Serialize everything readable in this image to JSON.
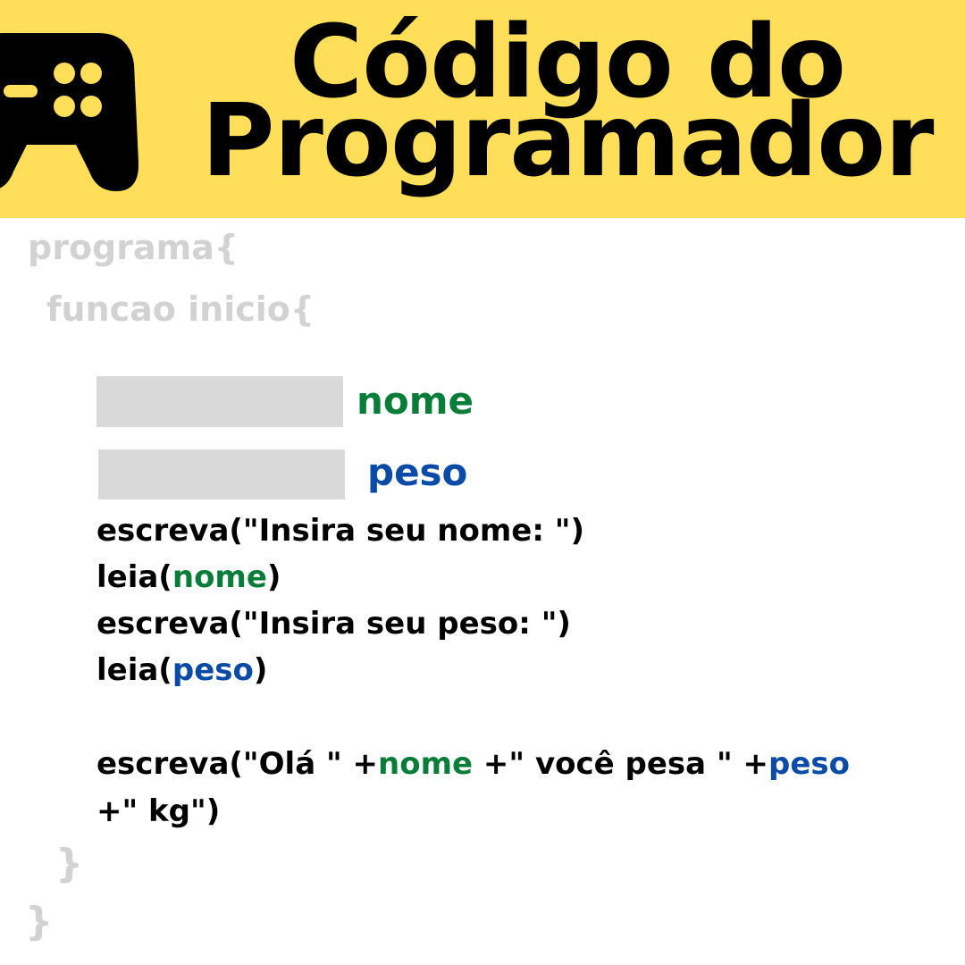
{
  "header": {
    "title_line_1": "Código do",
    "title_line_2": "Programador",
    "background_color": "#ffde59",
    "icon": "gamepad-icon"
  },
  "code": {
    "line_program": "programa{",
    "line_function": "funcao inicio{",
    "declarations": [
      {
        "variable": "nome",
        "color": "#087d38"
      },
      {
        "variable": "peso",
        "color": "#0a4ba8"
      }
    ],
    "stmt1": "escreva(\"Insira seu nome: \")",
    "stmt2_prefix": "leia(",
    "stmt2_var": "nome",
    "stmt2_suffix": ")",
    "stmt3": "escreva(\"Insira seu peso: \")",
    "stmt4_prefix": "leia(",
    "stmt4_var": "peso",
    "stmt4_suffix": ")",
    "stmt5_part1": "escreva(\"Olá \" +",
    "stmt5_var1": "nome",
    "stmt5_part2": " +\" você pesa \" +",
    "stmt5_var2": "peso",
    "stmt5_cont": "+\" kg\")",
    "close_function": "}",
    "close_program": "}"
  },
  "colors": {
    "keyword_gray": "#d2d2d2",
    "statement_black": "#000000",
    "var_nome_green": "#087d38",
    "var_peso_blue": "#0a4ba8",
    "blank_box": "#d9d9d9"
  }
}
